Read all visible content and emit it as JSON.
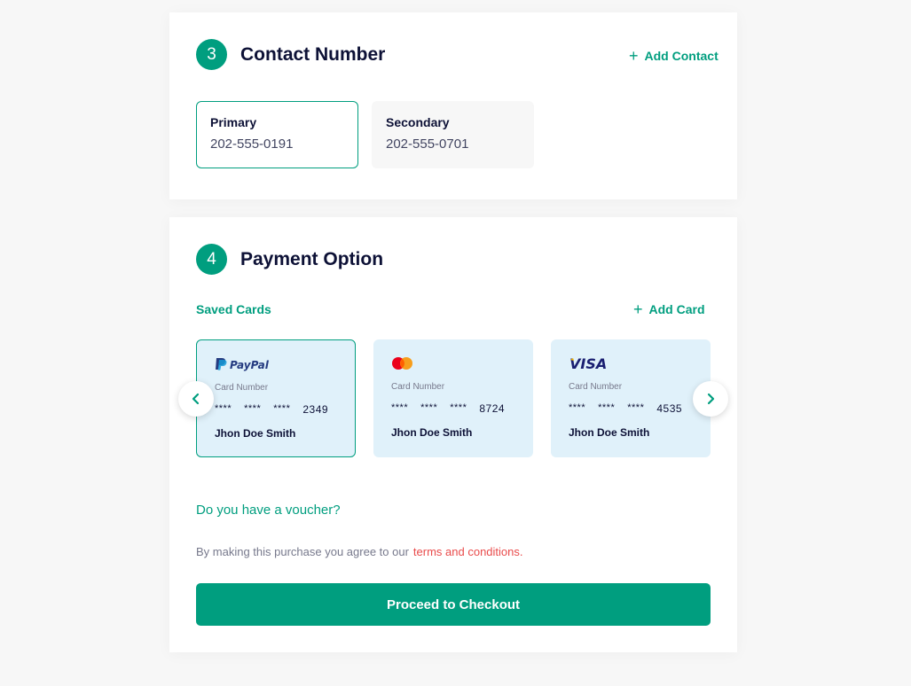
{
  "contact": {
    "step": "3",
    "title": "Contact Number",
    "add_label": "Add Contact",
    "numbers": [
      {
        "label": "Primary",
        "number": "202-555-0191"
      },
      {
        "label": "Secondary",
        "number": "202-555-0701"
      }
    ]
  },
  "payment": {
    "step": "4",
    "title": "Payment Option",
    "saved_cards_label": "Saved Cards",
    "add_card_label": "Add Card",
    "cards": [
      {
        "brand": "PayPal",
        "brand_icon": "paypal-logo",
        "number_label": "Card Number",
        "masked": [
          "****",
          "****",
          "****"
        ],
        "last4": "2349",
        "holder": "Jhon Doe Smith",
        "selected": true
      },
      {
        "brand": "MasterCard",
        "brand_icon": "mastercard-logo",
        "number_label": "Card Number",
        "masked": [
          "****",
          "****",
          "****"
        ],
        "last4": "8724",
        "holder": "Jhon Doe Smith",
        "selected": false
      },
      {
        "brand": "VISA",
        "brand_icon": "visa-logo",
        "number_label": "Card Number",
        "masked": [
          "****",
          "****",
          "****"
        ],
        "last4": "4535",
        "holder": "Jhon Doe Smith",
        "selected": false
      }
    ],
    "voucher_label": "Do you have a voucher?",
    "terms_prefix": "By making this purchase you agree to our",
    "terms_link": "terms and conditions",
    "terms_suffix": ".",
    "checkout_label": "Proceed to Checkout"
  },
  "colors": {
    "accent": "#009e7f",
    "card_bg": "#e0f1fa",
    "terms_link": "#e94b4b",
    "page_bg": "#f7f7f7"
  }
}
